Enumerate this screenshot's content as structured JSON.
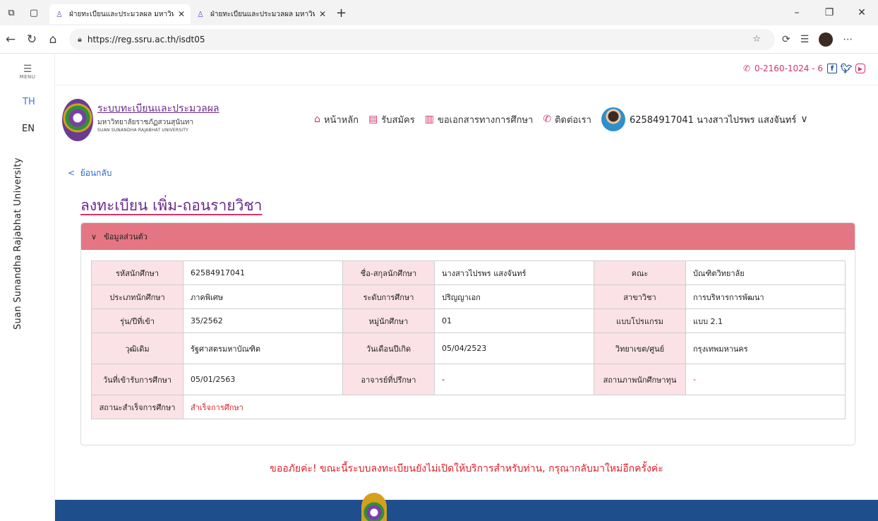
{
  "browser": {
    "tabs": [
      {
        "title": "ฝ่ายทะเบียนและประมวลผล มหาวิทยาลั",
        "active": true
      },
      {
        "title": "ฝ่ายทะเบียนและประมวลผล มหาวิทยาลั",
        "active": false
      }
    ],
    "url": "https://reg.ssru.ac.th/isdt05"
  },
  "siderail": {
    "menu_label": "MENU",
    "lang_th": "TH",
    "lang_en": "EN",
    "vertical_text": "Suan Sunandha Rajabhat University"
  },
  "header": {
    "phone": "0-2160-1024 - 6",
    "brand_title": "ระบบทะเบียนและประมวลผล",
    "brand_sub_th": "มหาวิทยาลัยราชภัฏสวนสุนันทา",
    "brand_sub_en": "SUAN SUNANDHA RAJABHAT UNIVERSITY",
    "nav": {
      "home": "หน้าหลัก",
      "apply": "รับสมัคร",
      "request_docs": "ขอเอกสารทางการศึกษา",
      "contact": "ติดต่อเรา"
    },
    "user": "62584917041 นางสาวไปรพร แสงจันทร์"
  },
  "main": {
    "back": "ย้อนกลับ",
    "title": "ลงทะเบียน เพิ่ม-ถอนรายวิชา",
    "panel_title": "ข้อมูลส่วนตัว",
    "rows": [
      [
        {
          "k": "รหัสนักศึกษา",
          "v": "62584917041"
        },
        {
          "k": "ชื่อ-สกุลนักศึกษา",
          "v": "นางสาวไปรพร แสงจันทร์"
        },
        {
          "k": "คณะ",
          "v": "บัณฑิตวิทยาลัย"
        }
      ],
      [
        {
          "k": "ประเภทนักศึกษา",
          "v": "ภาคพิเศษ"
        },
        {
          "k": "ระดับการศึกษา",
          "v": "ปริญญาเอก"
        },
        {
          "k": "สาขาวิชา",
          "v": "การบริหารการพัฒนา"
        }
      ],
      [
        {
          "k": "รุ่น/ปีที่เข้า",
          "v": "35/2562"
        },
        {
          "k": "หมู่นักศึกษา",
          "v": "01"
        },
        {
          "k": "แบบโปรแกรม",
          "v": "แบบ 2.1"
        }
      ],
      [
        {
          "k": "วุฒิเดิม",
          "v": "รัฐศาสตรมหาบัณฑิต"
        },
        {
          "k": "วันเดือนปีเกิด",
          "v": "05/04/2523"
        },
        {
          "k": "วิทยาเขต/ศูนย์",
          "v": "กรุงเทพมหานคร"
        }
      ],
      [
        {
          "k": "วันที่เข้ารับการศึกษา",
          "v": "05/01/2563"
        },
        {
          "k": "อาจารย์ที่ปรึกษา",
          "v": "-"
        },
        {
          "k": "สถานภาพนักศึกษาทุน",
          "v": "-"
        }
      ],
      [
        {
          "k": "สถานะสำเร็จการศึกษา",
          "v": "สำเร็จการศึกษา"
        }
      ]
    ],
    "notice": "ขออภัยค่ะ! ขณะนี้ระบบลงทะเบียนยังไม่เปิดให้บริการสำหรับท่าน, กรุณากลับมาใหม่อีกครั้งค่ะ"
  },
  "colors": {
    "accent_pink": "#e47683",
    "key_cell_bg": "#fbe2e6",
    "alert_red": "#e0202a",
    "footer_blue": "#1f4e8c"
  }
}
